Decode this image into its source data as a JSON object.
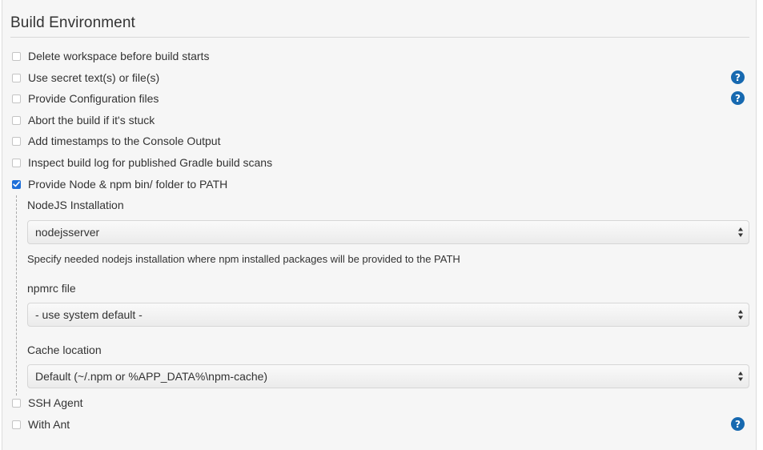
{
  "section": {
    "title": "Build Environment"
  },
  "options": [
    {
      "label": "Delete workspace before build starts",
      "checked": false,
      "help": false
    },
    {
      "label": "Use secret text(s) or file(s)",
      "checked": false,
      "help": true
    },
    {
      "label": "Provide Configuration files",
      "checked": false,
      "help": true
    },
    {
      "label": "Abort the build if it's stuck",
      "checked": false,
      "help": false
    },
    {
      "label": "Add timestamps to the Console Output",
      "checked": false,
      "help": false
    },
    {
      "label": "Inspect build log for published Gradle build scans",
      "checked": false,
      "help": false
    },
    {
      "label": "Provide Node & npm bin/ folder to PATH",
      "checked": true,
      "help": false
    },
    {
      "label": "SSH Agent",
      "checked": false,
      "help": false
    },
    {
      "label": "With Ant",
      "checked": false,
      "help": true
    }
  ],
  "node": {
    "installation_label": "NodeJS Installation",
    "installation_value": "nodejsserver",
    "installation_hint": "Specify needed nodejs installation where npm installed packages will be provided to the PATH",
    "npmrc_label": "npmrc file",
    "npmrc_value": "- use system default -",
    "cache_label": "Cache location",
    "cache_value": "Default (~/.npm or %APP_DATA%\\npm-cache)"
  },
  "help_glyph": "?",
  "colors": {
    "accent": "#1e6fd9",
    "help_icon": "#1769b0",
    "panel_bg": "#f6f6f6"
  }
}
